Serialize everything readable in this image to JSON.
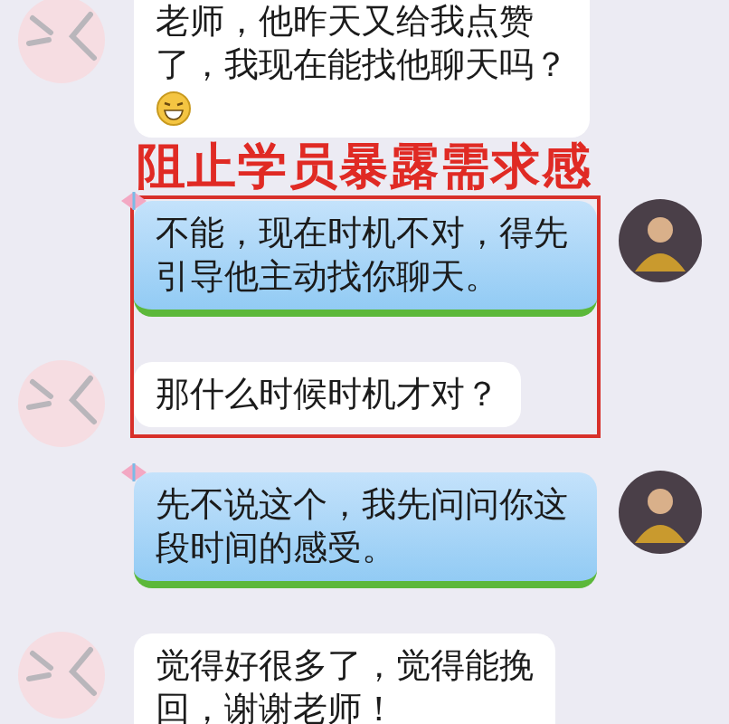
{
  "chat": [
    {
      "kind": "received",
      "lines": [
        "老师，他昨天又给我点赞",
        "了，我现在能找他聊天吗？"
      ],
      "emoji": true
    },
    {
      "kind": "annotation",
      "text": "阻止学员暴露需求感"
    },
    {
      "kind": "highlight_group",
      "messages": [
        {
          "kind": "sent",
          "lines": [
            "不能，现在时机不对，得先",
            "引导他主动找你聊天。"
          ]
        },
        {
          "kind": "received",
          "lines": [
            "那什么时候时机才对？"
          ]
        }
      ]
    },
    {
      "kind": "sent",
      "lines": [
        "先不说这个，我先问问你这",
        "段时间的感受。"
      ]
    },
    {
      "kind": "received",
      "lines": [
        "觉得好很多了，觉得能挽",
        "回，谢谢老师！"
      ]
    }
  ]
}
